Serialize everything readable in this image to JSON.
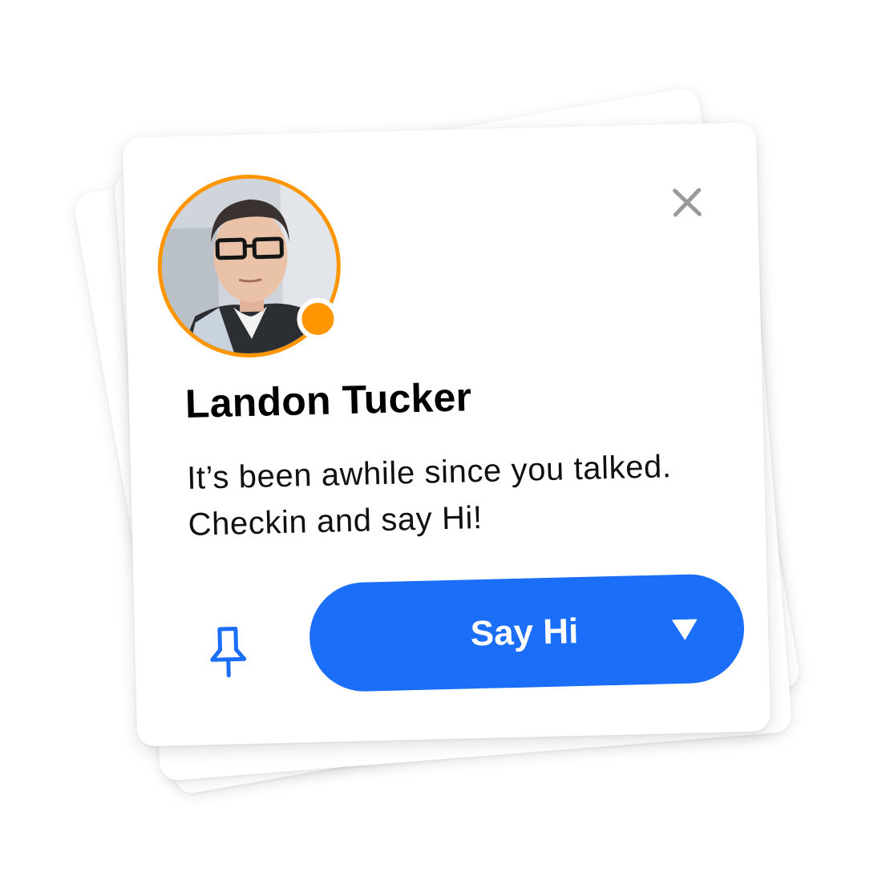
{
  "card": {
    "name": "Landon Tucker",
    "message": "It’s been awhile since you talked. Checkin and say Hi!",
    "primary_action_label": "Say Hi",
    "close_icon": "close-icon",
    "pin_icon": "pin-icon",
    "dropdown_icon": "caret-down-icon"
  },
  "colors": {
    "accent": "#1a6ef7",
    "status": "#ff9500",
    "avatar_ring": "#ff9500",
    "close_icon": "#9a9a9a"
  }
}
